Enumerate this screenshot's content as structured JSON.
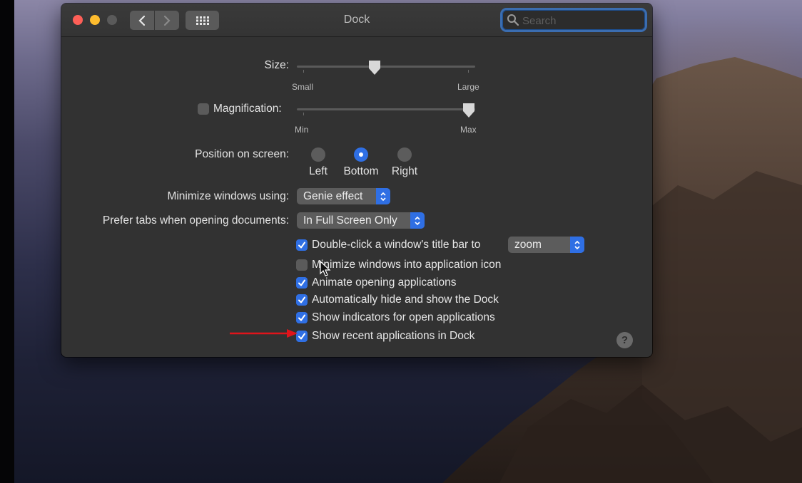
{
  "window": {
    "title": "Dock",
    "search_placeholder": "Search"
  },
  "settings": {
    "size": {
      "label": "Size:",
      "min_label": "Small",
      "max_label": "Large",
      "value": 0.43
    },
    "magnification": {
      "label": "Magnification:",
      "checked": false,
      "min_label": "Min",
      "max_label": "Max",
      "value": 1.0
    },
    "position": {
      "label": "Position on screen:",
      "options": [
        "Left",
        "Bottom",
        "Right"
      ],
      "selected": "Bottom"
    },
    "minimize_using": {
      "label": "Minimize windows using:",
      "value": "Genie effect"
    },
    "prefer_tabs": {
      "label": "Prefer tabs when opening documents:",
      "value": "In Full Screen Only"
    },
    "double_click": {
      "label": "Double-click a window's title bar to",
      "value": "zoom",
      "checked": true
    },
    "checkboxes": [
      {
        "label": "Minimize windows into application icon",
        "checked": false
      },
      {
        "label": "Animate opening applications",
        "checked": true
      },
      {
        "label": "Automatically hide and show the Dock",
        "checked": true
      },
      {
        "label": "Show indicators for open applications",
        "checked": true
      },
      {
        "label": "Show recent applications in Dock",
        "checked": true
      }
    ]
  },
  "help": {
    "label": "?"
  },
  "colors": {
    "accent": "#2f6fe4",
    "annotation_arrow": "#e0141b"
  }
}
